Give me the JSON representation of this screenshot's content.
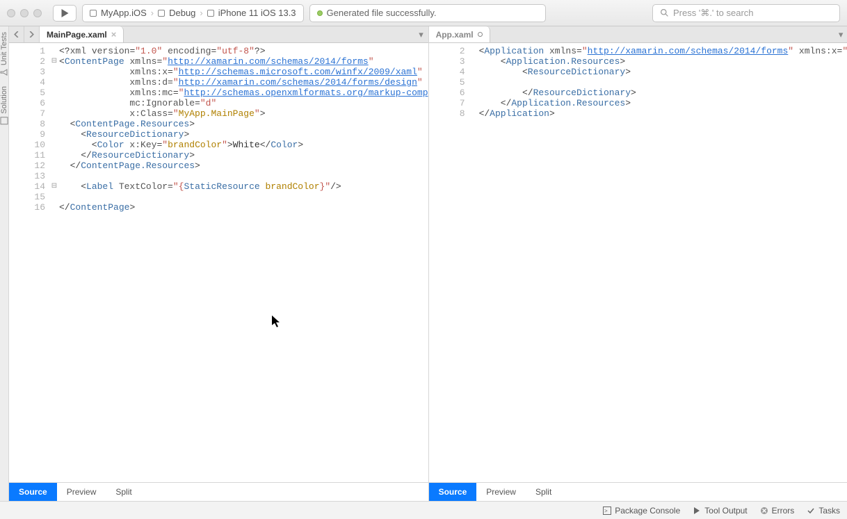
{
  "toolbar": {
    "target_project": "MyApp.iOS",
    "config": "Debug",
    "device": "iPhone 11 iOS 13.3",
    "status": "Generated file successfully.",
    "search_placeholder": "Press '⌘.' to search"
  },
  "sidebar": {
    "tabs": [
      "Unit Tests",
      "Solution"
    ]
  },
  "panes": [
    {
      "tab": "MainPage.xaml",
      "dirty": false,
      "view_modes": [
        "Source",
        "Preview",
        "Split"
      ],
      "active_view": 0,
      "lines": [
        {
          "n": 1,
          "fold": "",
          "tokens": [
            [
              "punct",
              "<?"
            ],
            [
              "attr",
              "xml version"
            ],
            [
              "eq",
              "="
            ],
            [
              "str",
              "\"1.0\""
            ],
            [
              "attr",
              " encoding"
            ],
            [
              "eq",
              "="
            ],
            [
              "str",
              "\"utf-8\""
            ],
            [
              "punct",
              "?>"
            ]
          ]
        },
        {
          "n": 2,
          "fold": "⊟",
          "tokens": [
            [
              "punct",
              "<"
            ],
            [
              "tag",
              "ContentPage"
            ],
            [
              "attr",
              " xmlns"
            ],
            [
              "eq",
              "="
            ],
            [
              "str",
              "\""
            ],
            [
              "url",
              "http://xamarin.com/schemas/2014/forms"
            ],
            [
              "str",
              "\""
            ]
          ]
        },
        {
          "n": 3,
          "fold": "",
          "tokens": [
            [
              "attr",
              "             xmlns:x"
            ],
            [
              "eq",
              "="
            ],
            [
              "str",
              "\""
            ],
            [
              "url",
              "http://schemas.microsoft.com/winfx/2009/xaml"
            ],
            [
              "str",
              "\""
            ]
          ]
        },
        {
          "n": 4,
          "fold": "",
          "tokens": [
            [
              "attr",
              "             xmlns:d"
            ],
            [
              "eq",
              "="
            ],
            [
              "str",
              "\""
            ],
            [
              "url",
              "http://xamarin.com/schemas/2014/forms/design"
            ],
            [
              "str",
              "\""
            ]
          ]
        },
        {
          "n": 5,
          "fold": "",
          "tokens": [
            [
              "attr",
              "             xmlns:mc"
            ],
            [
              "eq",
              "="
            ],
            [
              "str",
              "\""
            ],
            [
              "url",
              "http://schemas.openxmlformats.org/markup-comp"
            ]
          ]
        },
        {
          "n": 6,
          "fold": "",
          "tokens": [
            [
              "attr",
              "             mc:Ignorable"
            ],
            [
              "eq",
              "="
            ],
            [
              "str",
              "\"d\""
            ]
          ]
        },
        {
          "n": 7,
          "fold": "",
          "tokens": [
            [
              "attr",
              "             x:Class"
            ],
            [
              "eq",
              "="
            ],
            [
              "str",
              "\""
            ],
            [
              "key",
              "MyApp.MainPage"
            ],
            [
              "str",
              "\""
            ],
            [
              "punct",
              ">"
            ]
          ]
        },
        {
          "n": 8,
          "fold": "",
          "tokens": [
            [
              "punct",
              "  <"
            ],
            [
              "tag",
              "ContentPage.Resources"
            ],
            [
              "punct",
              ">"
            ]
          ]
        },
        {
          "n": 9,
          "fold": "",
          "tokens": [
            [
              "punct",
              "    <"
            ],
            [
              "tag",
              "ResourceDictionary"
            ],
            [
              "punct",
              ">"
            ]
          ]
        },
        {
          "n": 10,
          "fold": "",
          "tokens": [
            [
              "punct",
              "      <"
            ],
            [
              "tag",
              "Color"
            ],
            [
              "attr",
              " x:Key"
            ],
            [
              "eq",
              "="
            ],
            [
              "str",
              "\""
            ],
            [
              "key",
              "brandColor"
            ],
            [
              "str",
              "\""
            ],
            [
              "punct",
              ">"
            ],
            [
              "white",
              "White"
            ],
            [
              "punct",
              "</"
            ],
            [
              "tag",
              "Color"
            ],
            [
              "punct",
              ">"
            ]
          ]
        },
        {
          "n": 11,
          "fold": "",
          "tokens": [
            [
              "punct",
              "    </"
            ],
            [
              "tag",
              "ResourceDictionary"
            ],
            [
              "punct",
              ">"
            ]
          ]
        },
        {
          "n": 12,
          "fold": "",
          "tokens": [
            [
              "punct",
              "  </"
            ],
            [
              "tag",
              "ContentPage.Resources"
            ],
            [
              "punct",
              ">"
            ]
          ]
        },
        {
          "n": 13,
          "fold": "",
          "tokens": [
            [
              "white",
              ""
            ]
          ]
        },
        {
          "n": 14,
          "fold": "⊟",
          "tokens": [
            [
              "punct",
              "    <"
            ],
            [
              "tag",
              "Label"
            ],
            [
              "attr",
              " TextColor"
            ],
            [
              "eq",
              "="
            ],
            [
              "str",
              "\"{"
            ],
            [
              "static",
              "StaticResource "
            ],
            [
              "key",
              "brandColor"
            ],
            [
              "str",
              "}\""
            ],
            [
              "punct",
              "/>"
            ]
          ]
        },
        {
          "n": 15,
          "fold": "",
          "tokens": [
            [
              "white",
              ""
            ]
          ]
        },
        {
          "n": 16,
          "fold": "",
          "tokens": [
            [
              "punct",
              "</"
            ],
            [
              "tag",
              "ContentPage"
            ],
            [
              "punct",
              ">"
            ]
          ]
        }
      ]
    },
    {
      "tab": "App.xaml",
      "dirty": true,
      "view_modes": [
        "Source",
        "Preview",
        "Split"
      ],
      "active_view": 0,
      "lines": [
        {
          "n": 2,
          "fold": "",
          "tokens": [
            [
              "punct",
              "<"
            ],
            [
              "tag",
              "Application"
            ],
            [
              "attr",
              " xmlns"
            ],
            [
              "eq",
              "="
            ],
            [
              "str",
              "\""
            ],
            [
              "url",
              "http://xamarin.com/schemas/2014/forms"
            ],
            [
              "str",
              "\""
            ],
            [
              "attr",
              " xmlns:x"
            ],
            [
              "eq",
              "="
            ],
            [
              "str",
              "\""
            ]
          ]
        },
        {
          "n": 3,
          "fold": "",
          "tokens": [
            [
              "punct",
              "    <"
            ],
            [
              "tag",
              "Application.Resources"
            ],
            [
              "punct",
              ">"
            ]
          ]
        },
        {
          "n": 4,
          "fold": "",
          "tokens": [
            [
              "punct",
              "        <"
            ],
            [
              "tag",
              "ResourceDictionary"
            ],
            [
              "punct",
              ">"
            ]
          ]
        },
        {
          "n": 5,
          "fold": "",
          "tokens": [
            [
              "white",
              ""
            ]
          ]
        },
        {
          "n": 6,
          "fold": "",
          "tokens": [
            [
              "punct",
              "        </"
            ],
            [
              "tag",
              "ResourceDictionary"
            ],
            [
              "punct",
              ">"
            ]
          ]
        },
        {
          "n": 7,
          "fold": "",
          "tokens": [
            [
              "punct",
              "    </"
            ],
            [
              "tag",
              "Application.Resources"
            ],
            [
              "punct",
              ">"
            ]
          ]
        },
        {
          "n": 8,
          "fold": "",
          "tokens": [
            [
              "punct",
              "</"
            ],
            [
              "tag",
              "Application"
            ],
            [
              "punct",
              ">"
            ]
          ]
        }
      ]
    }
  ],
  "statusbar": {
    "items": [
      "Package Console",
      "Tool Output",
      "Errors",
      "Tasks"
    ]
  }
}
